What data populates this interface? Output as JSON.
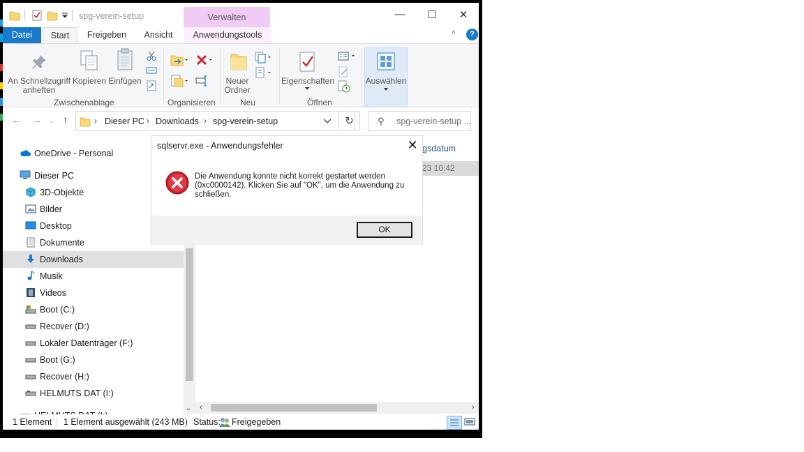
{
  "window": {
    "title": "spg-verein-setup",
    "context_tab_header": "Verwalten",
    "controls": {
      "minimize": "—",
      "maximize": "☐",
      "close": "✕"
    }
  },
  "ribbon_tabs": [
    {
      "label": "Datei"
    },
    {
      "label": "Start"
    },
    {
      "label": "Freigeben"
    },
    {
      "label": "Ansicht"
    },
    {
      "label": "Anwendungstools"
    }
  ],
  "ribbon_help": {
    "collapse": "^",
    "help": "?"
  },
  "ribbon": {
    "pin_line1": "An Schnellzugriff",
    "pin_line2": "anheften",
    "copy": "Kopieren",
    "paste": "Einfügen",
    "new_folder_line1": "Neuer",
    "new_folder_line2": "Ordner",
    "properties": "Eigenschaften",
    "select": "Auswählen",
    "groups": {
      "clipboard": "Zwischenablage",
      "organize": "Organisieren",
      "new": "Neu",
      "open": "Öffnen"
    }
  },
  "address": {
    "breadcrumbs": [
      "Dieser PC",
      "Downloads",
      "spg-verein-setup"
    ],
    "search_placeholder": "spg-verein-setup ..."
  },
  "nav_items": [
    {
      "label": "OneDrive - Personal",
      "icon": "cloud-icon"
    },
    {
      "label": "Dieser PC",
      "icon": "computer-icon"
    },
    {
      "label": "3D-Objekte",
      "icon": "cube-icon"
    },
    {
      "label": "Bilder",
      "icon": "pictures-icon"
    },
    {
      "label": "Desktop",
      "icon": "desktop-icon"
    },
    {
      "label": "Dokumente",
      "icon": "document-icon"
    },
    {
      "label": "Downloads",
      "icon": "download-icon",
      "selected": true
    },
    {
      "label": "Musik",
      "icon": "music-icon"
    },
    {
      "label": "Videos",
      "icon": "video-icon"
    },
    {
      "label": "Boot (C:)",
      "icon": "system-drive-icon"
    },
    {
      "label": "Recover (D:)",
      "icon": "drive-icon"
    },
    {
      "label": "Lokaler Datenträger (F:)",
      "icon": "drive-icon"
    },
    {
      "label": "Boot (G:)",
      "icon": "drive-icon"
    },
    {
      "label": "Recover (H:)",
      "icon": "drive-icon"
    },
    {
      "label": "HELMUTS DAT (I:)",
      "icon": "usb-drive-icon"
    },
    {
      "label": "HELMUTS DAT (I:)",
      "icon": "usb-drive-icon"
    }
  ],
  "content": {
    "column_header": "gsdatum",
    "selected_row_date": "23 10:42"
  },
  "status": {
    "count": "1 Element",
    "selection": "1 Element ausgewählt (243 MB)",
    "status_label": "Status:",
    "status_value": "Freigegeben"
  },
  "dialog": {
    "title": "sqlservr.exe - Anwendungsfehler",
    "message": "Die Anwendung konnte nicht korrekt gestartet werden (0xc0000142). Klicken Sie auf \"OK\", um die Anwendung zu schließen.",
    "ok_label": "OK",
    "close": "✕"
  },
  "colors": {
    "file_tab": "#1979ca",
    "context_tab": "#f0ccf4",
    "selection": "#e0dfe2",
    "error_red": "#d0232b"
  }
}
